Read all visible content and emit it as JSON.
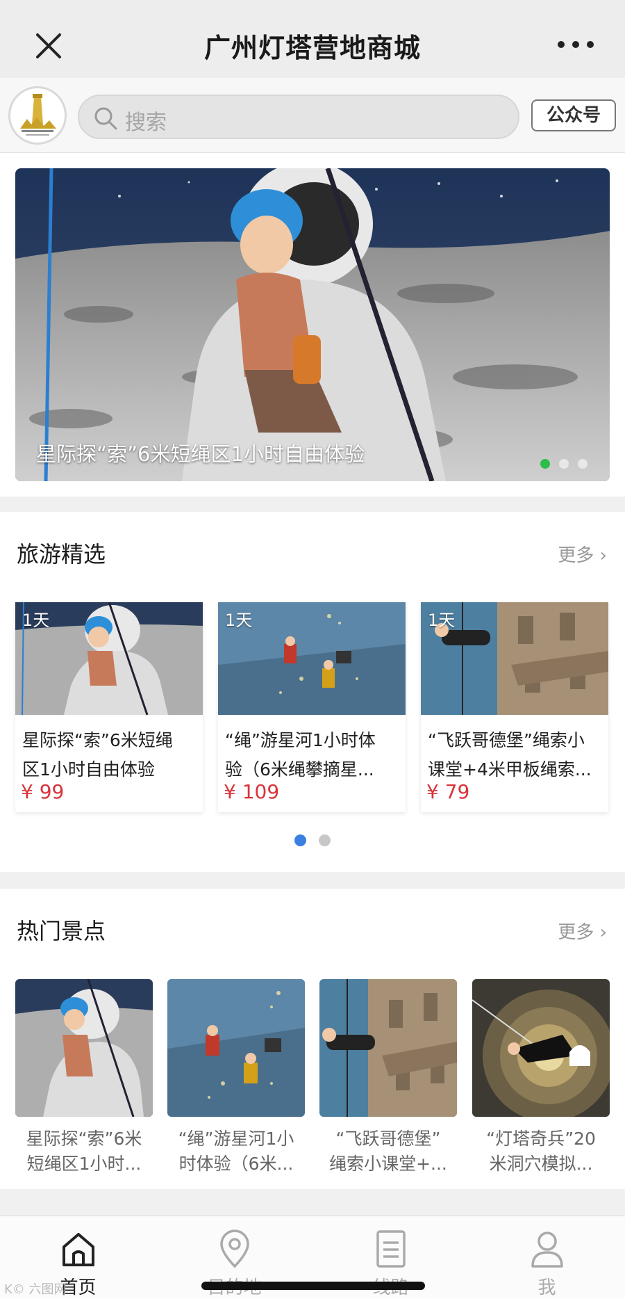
{
  "window": {
    "title": "广州灯塔营地商城",
    "close_icon": "close-icon",
    "more_icon": "more-icon"
  },
  "header": {
    "logo": "camp-logo",
    "search_placeholder": "搜索",
    "official_account_label": "公众号"
  },
  "banner": {
    "caption": "星际探“索”6米短绳区1小时自由体验",
    "slide_count": 3,
    "active_slide": 0,
    "active_dot_color": "#2ebd4b"
  },
  "tours": {
    "heading": "旅游精选",
    "more_label": "更多",
    "items": [
      {
        "badge": "1天",
        "name_line1": "星际探“索”6米短绳",
        "name_line2": "区1小时自由体验",
        "price": "¥ 99"
      },
      {
        "badge": "1天",
        "name_line1": "“绳”游星河1小时体",
        "name_line2": "验（6米绳攀摘星...",
        "price": "¥ 109"
      },
      {
        "badge": "1天",
        "name_line1": "“飞跃哥德堡”绳索小",
        "name_line2": "课堂+4米甲板绳索...",
        "price": "¥ 79"
      }
    ],
    "page_count": 2,
    "active_page": 0,
    "price_color": "#d9333a",
    "active_pager_color": "#3b7fe2"
  },
  "spots": {
    "heading": "热门景点",
    "more_label": "更多",
    "items": [
      {
        "line1": "星际探“索”6米",
        "line2": "短绳区1小时..."
      },
      {
        "line1": "“绳”游星河1小",
        "line2": "时体验（6米..."
      },
      {
        "line1": "“飞跃哥德堡”",
        "line2": "绳索小课堂+..."
      },
      {
        "line1": "“灯塔奇兵”20",
        "line2": "米洞穴模拟..."
      }
    ]
  },
  "tabbar": {
    "tabs": [
      {
        "label": "首页",
        "icon": "home-icon",
        "active": true
      },
      {
        "label": "目的地",
        "icon": "location-pin-icon",
        "active": false
      },
      {
        "label": "线路",
        "icon": "document-icon",
        "active": false
      },
      {
        "label": "我",
        "icon": "person-icon",
        "active": false
      }
    ]
  },
  "watermark": "K© 六图网"
}
